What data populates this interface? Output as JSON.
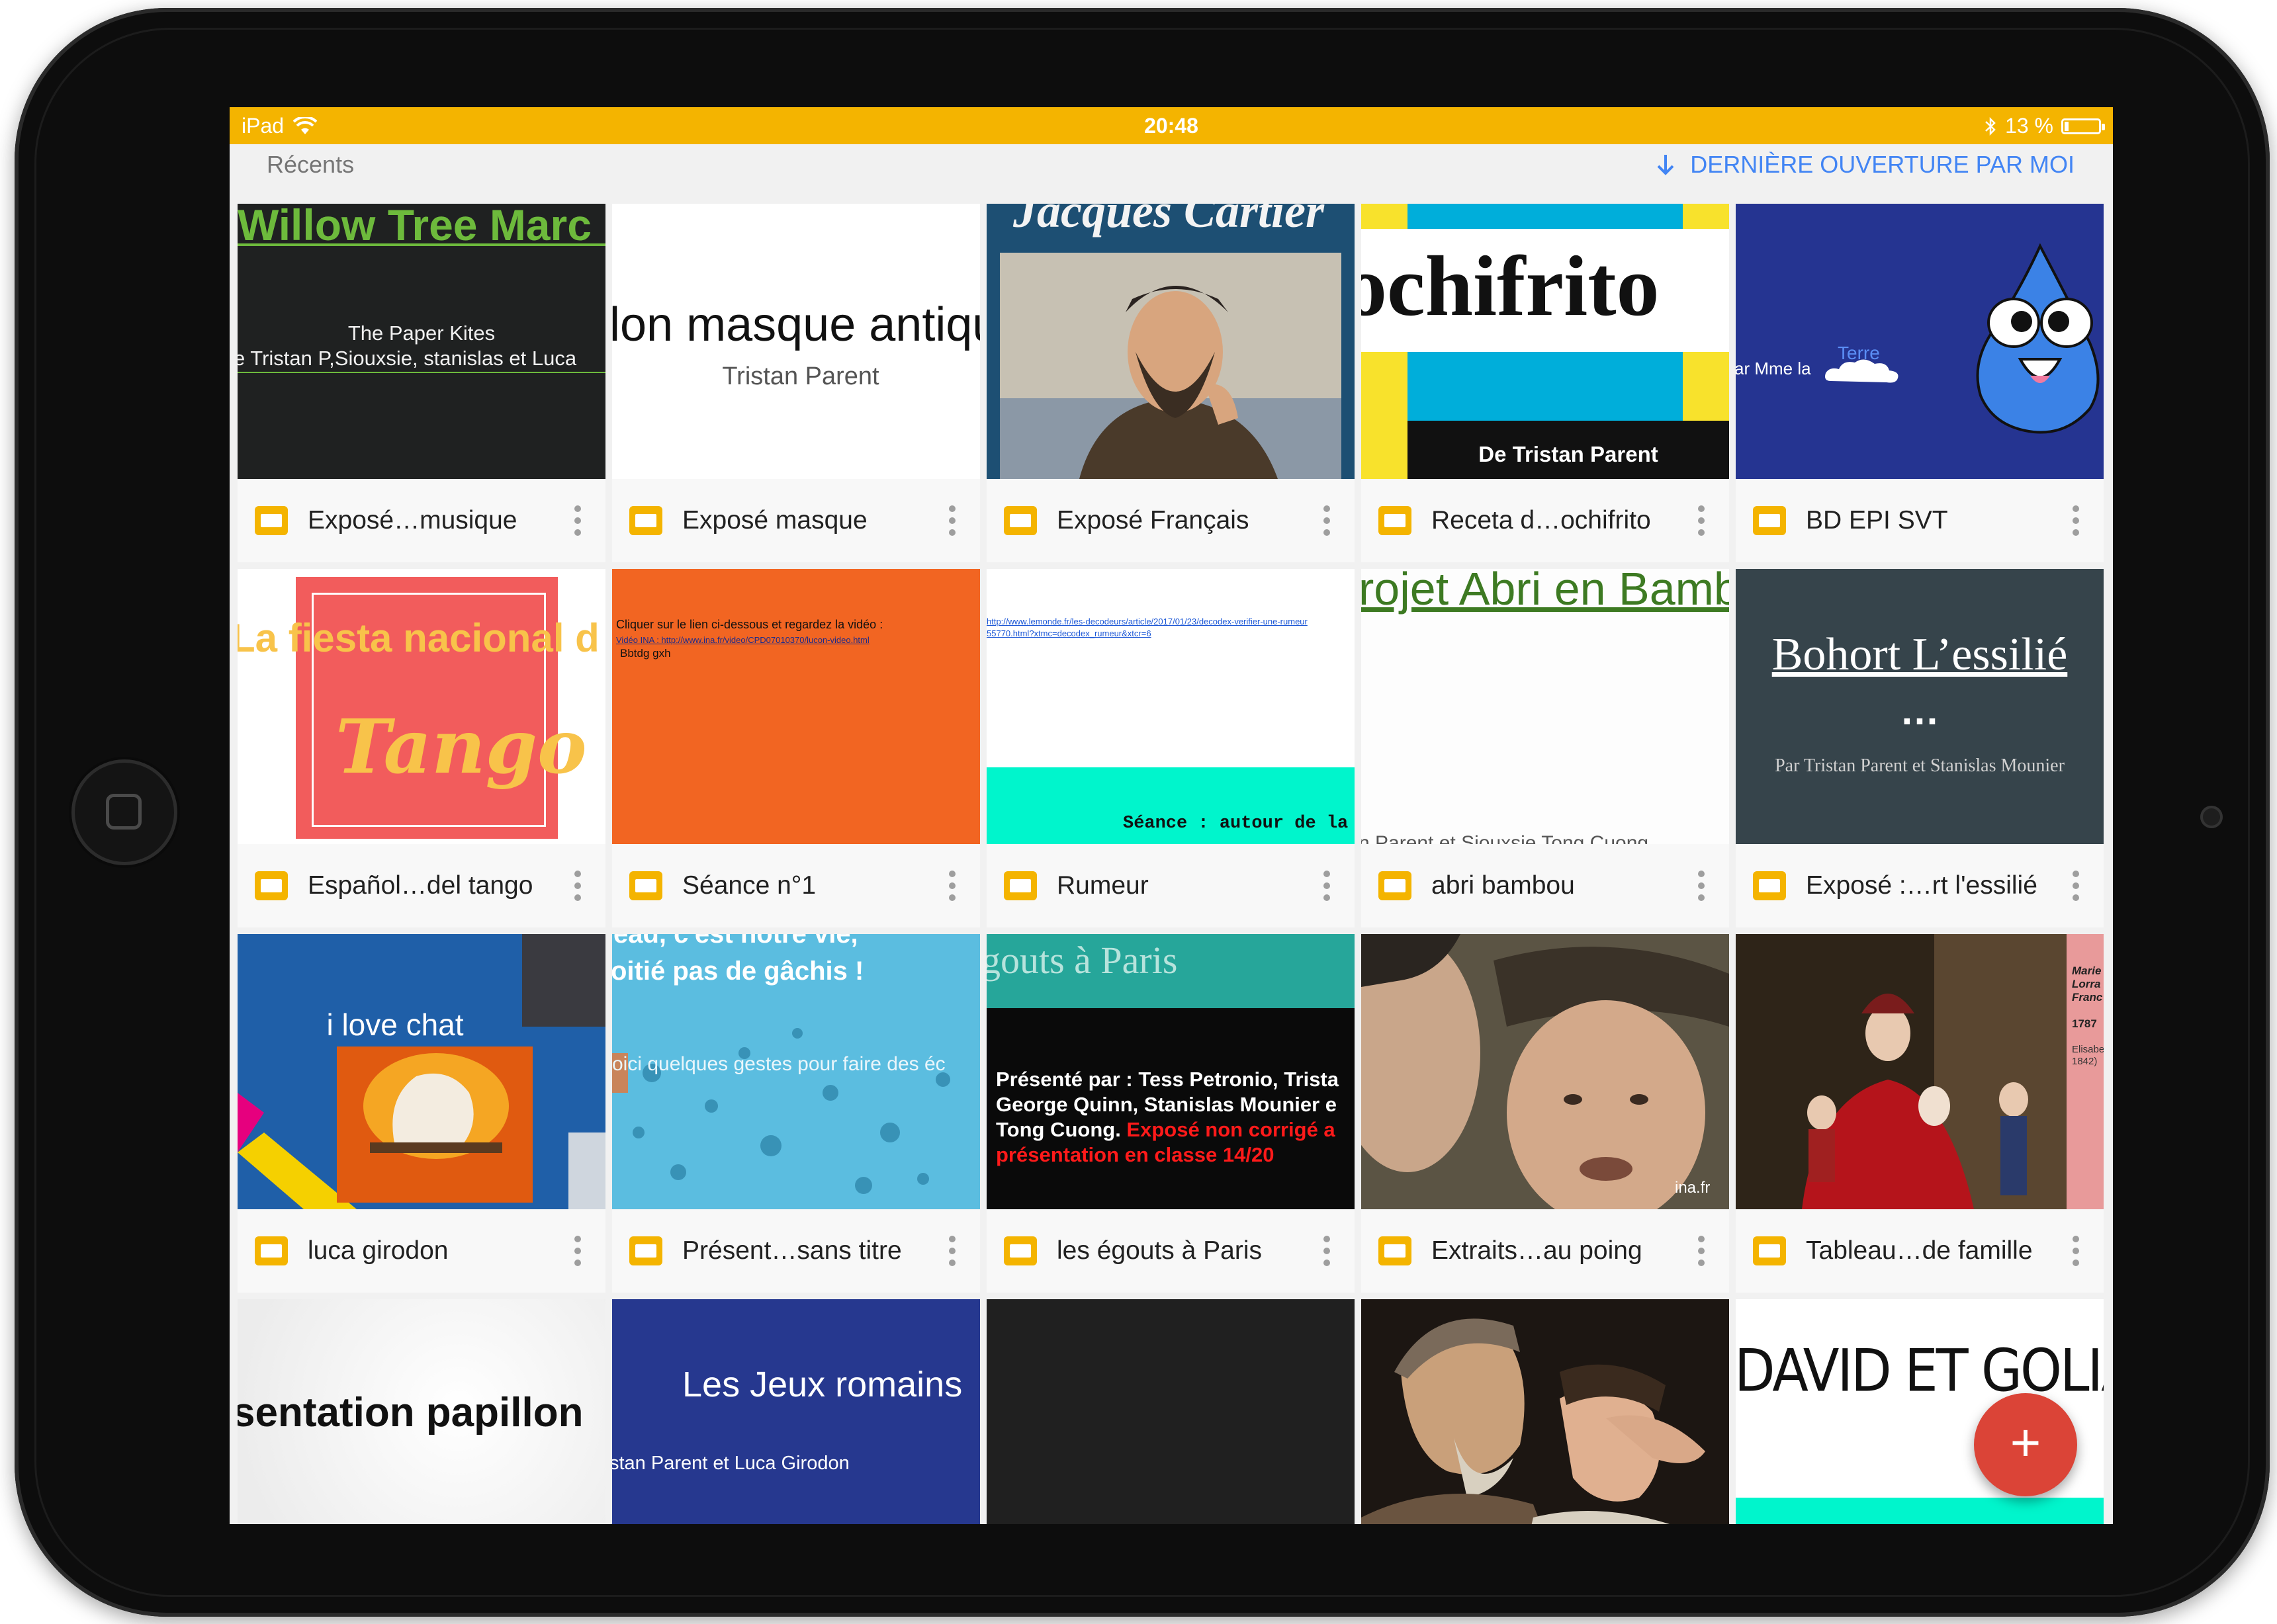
{
  "status_bar": {
    "device": "iPad",
    "time": "20:48",
    "battery": "13 %",
    "battery_level_percent": 13
  },
  "toolbar": {
    "section_title": "Récents",
    "sort_label": "DERNIÈRE OUVERTURE PAR MOI"
  },
  "colors": {
    "status_bar": "#f4b400",
    "accent_blue": "#4285f4",
    "slides_yellow": "#f4b400",
    "fab_red": "#db4437"
  },
  "fab": {
    "label": "+"
  },
  "files": [
    {
      "name": "Exposé…musique",
      "thumb": {
        "title": "Willow Tree Marc",
        "line1": "The Paper Kites",
        "line2": "e Tristan P,Siouxsie, stanislas et Luca"
      }
    },
    {
      "name": "Exposé masque",
      "thumb": {
        "title": "lon masque antiqu",
        "subtitle": "Tristan Parent"
      }
    },
    {
      "name": "Exposé Français",
      "thumb": {
        "title": "Jacques Cartier"
      }
    },
    {
      "name": "Receta d…ochifrito",
      "thumb": {
        "title": "ochifrito",
        "subtitle": "De Tristan Parent"
      }
    },
    {
      "name": "BD EPI SVT",
      "thumb": {
        "text": "ar Mme la",
        "cloud": "Terre"
      }
    },
    {
      "name": "Español…del tango",
      "thumb": {
        "title": "La fiesta nacional d",
        "script": "Tango"
      }
    },
    {
      "name": "Séance n°1",
      "thumb": {
        "line1": "Cliquer sur le lien ci-dessous et regardez la vidéo :",
        "line2": "Vidéo INA : http://www.ina.fr/video/CPD07010370/lucon-video.html",
        "line3": "Bbtdg gxh"
      }
    },
    {
      "name": "Rumeur",
      "thumb": {
        "link1": "http://www.lemonde.fr/les-decodeurs/article/2017/01/23/decodex-verifier-une-rumeur",
        "link2": "55770.html?xtmc=decodex_rumeur&xtcr=6",
        "banner": "Séance : autour de la"
      }
    },
    {
      "name": "abri bambou",
      "thumb": {
        "title": "rojet Abri en Bamb",
        "bottom": "n Parent et Siouxsie Tong Cuong"
      }
    },
    {
      "name": "Exposé :…rt l'essilié",
      "thumb": {
        "title": "Bohort L’essilié",
        "dots": "…",
        "subtitle": "Par Tristan Parent et Stanislas Mounier"
      }
    },
    {
      "name": "luca girodon",
      "thumb": {
        "title": "i love chat"
      }
    },
    {
      "name": "Présent…sans titre",
      "thumb": {
        "line1": "ead, c'est notre vie,",
        "line2": "oitié pas de gâchis !",
        "line3": "oici quelques gestes pour faire des éc"
      }
    },
    {
      "name": "les égouts à Paris",
      "thumb": {
        "title": "gouts à Paris",
        "line1": "Présenté par : Tess Petronio, Trista",
        "line2": "George Quinn, Stanislas Mounier e",
        "line3a": "Tong Cuong. ",
        "line3b": "Exposé non corrigé a",
        "line4": "présentation en classe 14/20"
      }
    },
    {
      "name": "Extraits…au poing",
      "thumb": {
        "watermark": "ina.fr"
      }
    },
    {
      "name": "Tableau…de famille",
      "thumb": {
        "side1": "Marie",
        "side2": "Lorra",
        "side3": "Franc",
        "year": "1787",
        "side4": "Elisabe",
        "side5": "1842)"
      }
    },
    {
      "name": "",
      "thumb": {
        "title": "sentation papillon"
      }
    },
    {
      "name": "",
      "thumb": {
        "title": "Les Jeux romains",
        "subtitle": "stan Parent et Luca Girodon"
      }
    },
    {
      "name": "",
      "thumb": {}
    },
    {
      "name": "",
      "thumb": {}
    },
    {
      "name": "",
      "thumb": {
        "title": "DAVID ET GOLIATH"
      }
    }
  ]
}
